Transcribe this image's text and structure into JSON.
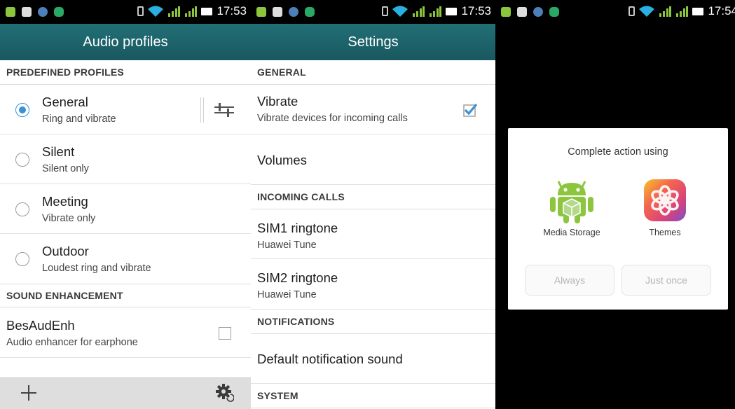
{
  "panel1": {
    "status_time": "17:53",
    "title": "Audio profiles",
    "section_predefined": "PREDEFINED PROFILES",
    "profiles": [
      {
        "name": "General",
        "desc": "Ring and vibrate",
        "selected": true
      },
      {
        "name": "Silent",
        "desc": "Silent only",
        "selected": false
      },
      {
        "name": "Meeting",
        "desc": "Vibrate only",
        "selected": false
      },
      {
        "name": "Outdoor",
        "desc": "Loudest ring and vibrate",
        "selected": false
      }
    ],
    "section_sound": "SOUND ENHANCEMENT",
    "enhancer": {
      "name": "BesAudEnh",
      "desc": "Audio enhancer for earphone",
      "checked": false
    }
  },
  "panel2": {
    "status_time": "17:53",
    "title": "Settings",
    "section_general": "GENERAL",
    "vibrate": {
      "name": "Vibrate",
      "desc": "Vibrate devices for incoming calls",
      "checked": true
    },
    "volumes": "Volumes",
    "section_incoming": "INCOMING CALLS",
    "sim1": {
      "name": "SIM1 ringtone",
      "desc": "Huawei Tune"
    },
    "sim2": {
      "name": "SIM2 ringtone",
      "desc": "Huawei Tune"
    },
    "section_notifications": "NOTIFICATIONS",
    "default_notification": "Default notification sound",
    "section_system": "SYSTEM"
  },
  "panel3": {
    "status_time": "17:54",
    "dialog_title": "Complete action using",
    "apps": [
      {
        "label": "Media Storage",
        "icon": "android-robot-icon"
      },
      {
        "label": "Themes",
        "icon": "themes-icon"
      }
    ],
    "always_label": "Always",
    "just_once_label": "Just once"
  },
  "colors": {
    "titlebar": "#1e6369",
    "accent": "#3a91d4",
    "android_green": "#8cc63f",
    "divider": "#dcdcdc"
  }
}
